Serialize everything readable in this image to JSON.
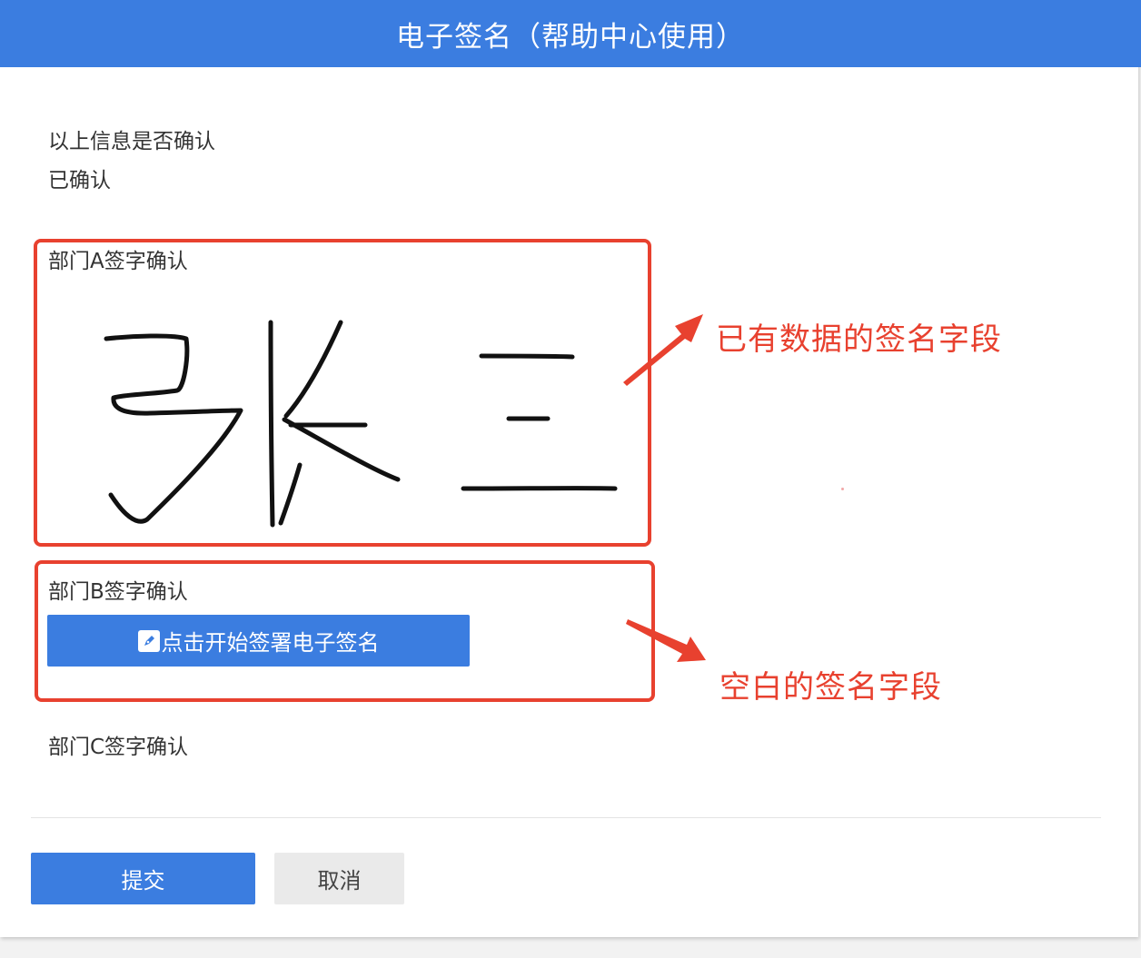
{
  "header": {
    "title": "电子签名（帮助中心使用）"
  },
  "confirmation": {
    "question": "以上信息是否确认",
    "answer": "已确认"
  },
  "sections": {
    "a": {
      "label": "部门A签字确认"
    },
    "b": {
      "label": "部门B签字确认",
      "button_label": "点击开始签署电子签名",
      "button_icon": "pen-icon"
    },
    "c": {
      "label": "部门C签字确认"
    }
  },
  "annotations": {
    "filled": "已有数据的签名字段",
    "empty": "空白的签名字段"
  },
  "footer": {
    "submit_label": "提交",
    "cancel_label": "取消"
  },
  "colors": {
    "header": "#3b7de0",
    "button": "#3b7de0",
    "annotation": "#e8412f"
  }
}
